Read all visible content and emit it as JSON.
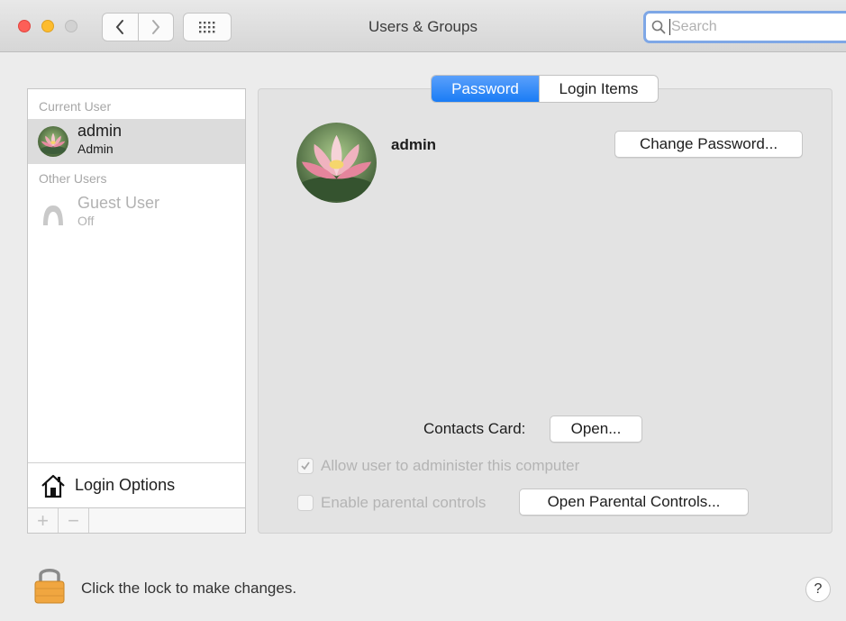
{
  "window": {
    "title": "Users & Groups",
    "search_placeholder": "Search"
  },
  "sidebar": {
    "current_user_header": "Current User",
    "current_user": {
      "name": "admin",
      "role": "Admin"
    },
    "other_users_header": "Other Users",
    "other_users": [
      {
        "name": "Guest User",
        "status": "Off"
      }
    ],
    "login_options_label": "Login Options",
    "add_label": "+",
    "remove_label": "−"
  },
  "tabs": [
    {
      "label": "Password",
      "selected": true
    },
    {
      "label": "Login Items",
      "selected": false
    }
  ],
  "main": {
    "user_name": "admin",
    "change_password_label": "Change Password...",
    "contacts_card_label": "Contacts Card:",
    "open_label": "Open...",
    "allow_admin_label": "Allow user to administer this computer",
    "allow_admin_checked": true,
    "parental_controls_label": "Enable parental controls",
    "parental_controls_checked": false,
    "open_parental_controls_label": "Open Parental Controls..."
  },
  "footer": {
    "lock_text": "Click the lock to make changes.",
    "help_label": "?"
  },
  "colors": {
    "accent": "#1a7cf5",
    "close": "#fd5f57",
    "minimize": "#fdbc2e",
    "lock": "#f0a640"
  }
}
